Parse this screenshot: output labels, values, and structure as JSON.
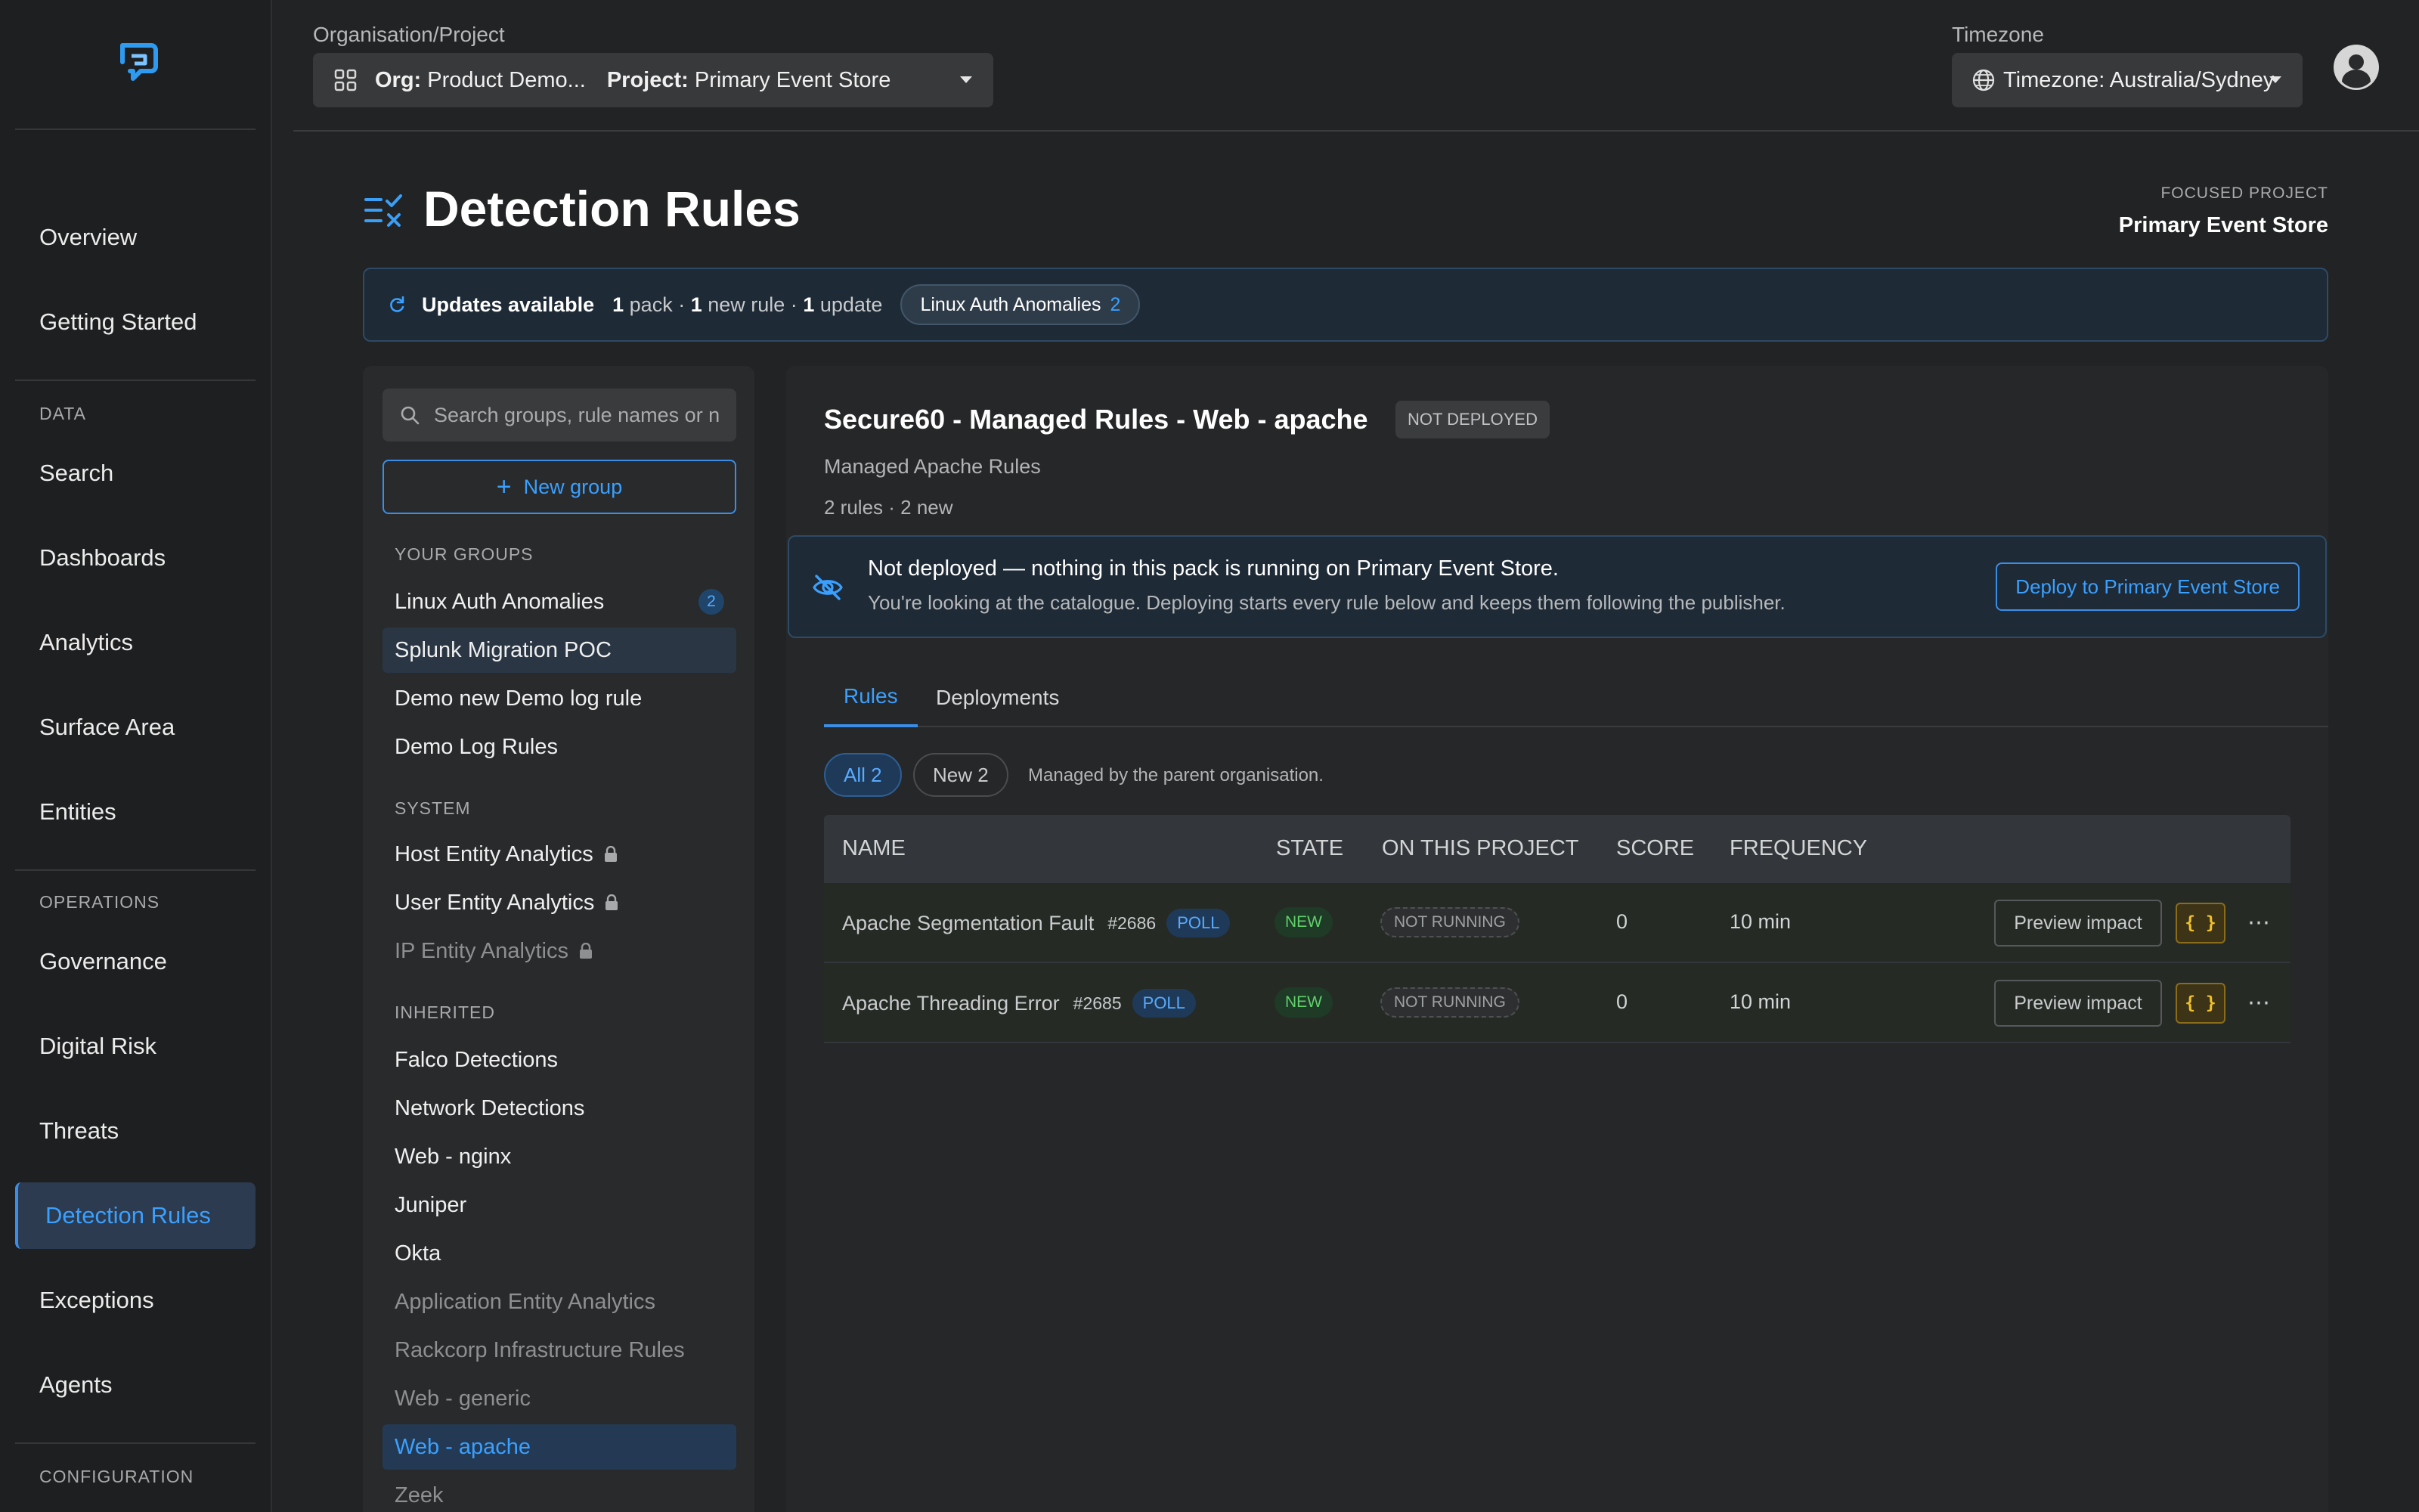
{
  "sidebar": {
    "items": [
      {
        "label": "Overview"
      },
      {
        "label": "Getting Started"
      },
      {
        "label": "Search"
      },
      {
        "label": "Dashboards"
      },
      {
        "label": "Analytics"
      },
      {
        "label": "Surface Area"
      },
      {
        "label": "Entities"
      },
      {
        "label": "Governance"
      },
      {
        "label": "Digital Risk"
      },
      {
        "label": "Threats"
      },
      {
        "label": "Detection Rules"
      },
      {
        "label": "Exceptions"
      },
      {
        "label": "Agents"
      }
    ],
    "sections": {
      "data": "DATA",
      "operations": "OPERATIONS",
      "configuration": "CONFIGURATION"
    },
    "active_item": "Detection Rules"
  },
  "header": {
    "org_label": "Organisation/Project",
    "org_key": "Org:",
    "org_value": "Product Demo...",
    "project_key": "Project:",
    "project_value": "Primary Event Store",
    "tz_label": "Timezone",
    "tz_value": "Timezone: Australia/Sydney"
  },
  "page": {
    "title": "Detection Rules",
    "focused_label": "FOCUSED PROJECT",
    "focused_value": "Primary Event Store"
  },
  "updates": {
    "title": "Updates available",
    "packs_count": "1",
    "packs_text": "pack ·",
    "new_count": "1",
    "new_text": "new rule ·",
    "update_count": "1",
    "update_text": "update",
    "pill_label": "Linux Auth Anomalies",
    "pill_count": "2"
  },
  "groups": {
    "search_placeholder": "Search groups, rule names or n",
    "new_group_label": "New group",
    "your_groups_heading": "YOUR GROUPS",
    "your_groups": [
      {
        "label": "Linux Auth Anomalies",
        "badge": "2"
      },
      {
        "label": "Splunk Migration POC"
      },
      {
        "label": "Demo new Demo log rule"
      },
      {
        "label": "Demo Log Rules"
      }
    ],
    "system_heading": "SYSTEM",
    "system": [
      {
        "label": "Host Entity Analytics"
      },
      {
        "label": "User Entity Analytics"
      },
      {
        "label": "IP Entity Analytics"
      }
    ],
    "inherited_heading": "INHERITED",
    "inherited": [
      {
        "label": "Falco Detections"
      },
      {
        "label": "Network Detections"
      },
      {
        "label": "Web - nginx"
      },
      {
        "label": "Juniper"
      },
      {
        "label": "Okta"
      },
      {
        "label": "Application Entity Analytics"
      },
      {
        "label": "Rackcorp Infrastructure Rules"
      },
      {
        "label": "Web - generic"
      },
      {
        "label": "Web - apache"
      },
      {
        "label": "Zeek"
      }
    ]
  },
  "pack": {
    "title": "Secure60 - Managed Rules - Web - apache",
    "status_badge": "NOT DEPLOYED",
    "subtitle": "Managed Apache Rules",
    "meta": "2 rules · 2 new",
    "notice_title": "Not deployed — nothing in this pack is running on Primary Event Store.",
    "notice_text": "You're looking at the catalogue. Deploying starts every rule below and keeps them following the publisher.",
    "deploy_label": "Deploy to Primary Event Store",
    "tabs": [
      {
        "label": "Rules"
      },
      {
        "label": "Deployments"
      }
    ],
    "filters": [
      {
        "label": "All 2"
      },
      {
        "label": "New 2"
      }
    ],
    "managed_note": "Managed by the parent organisation.",
    "table": {
      "headers": [
        "NAME",
        "STATE",
        "ON THIS PROJECT",
        "SCORE",
        "FREQUENCY"
      ],
      "rows": [
        {
          "name": "Apache Segmentation Fault",
          "id": "#2686",
          "tag": "POLL",
          "state": "NEW",
          "on_project": "NOT RUNNING",
          "score": "0",
          "frequency": "10 min",
          "preview": "Preview impact",
          "json": "{ }",
          "more": "⋯"
        },
        {
          "name": "Apache Threading Error",
          "id": "#2685",
          "tag": "POLL",
          "state": "NEW",
          "on_project": "NOT RUNNING",
          "score": "0",
          "frequency": "10 min",
          "preview": "Preview impact",
          "json": "{ }",
          "more": "⋯"
        }
      ]
    }
  },
  "colors": {
    "accent": "#3aa0ff",
    "background": "#222324",
    "sidebar": "#1e1f20",
    "new_state": "#5fd06a",
    "json_button": "#f0c12a"
  }
}
